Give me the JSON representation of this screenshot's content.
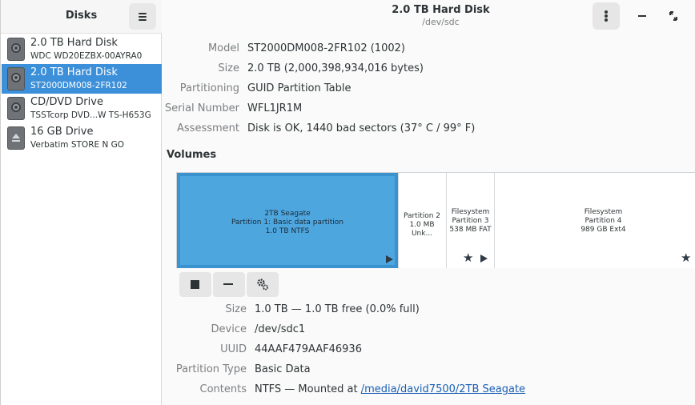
{
  "sidebar": {
    "title": "Disks",
    "drives": [
      {
        "name": "2.0 TB Hard Disk",
        "sub": "WDC WD20EZBX-00AYRA0",
        "icon": "hard-disk-icon",
        "selected": false
      },
      {
        "name": "2.0 TB Hard Disk",
        "sub": "ST2000DM008-2FR102",
        "icon": "hard-disk-icon",
        "selected": true
      },
      {
        "name": "CD/DVD Drive",
        "sub": "TSSTcorp DVD...W TS-H653G",
        "icon": "optical-drive-icon",
        "selected": false
      },
      {
        "name": "16 GB Drive",
        "sub": "Verbatim STORE N GO",
        "icon": "removable-drive-icon",
        "selected": false
      }
    ]
  },
  "header": {
    "title": "2.0 TB Hard Disk",
    "device": "/dev/sdc"
  },
  "disk_info": {
    "model_label": "Model",
    "model": "ST2000DM008-2FR102 (1002)",
    "size_label": "Size",
    "size": "2.0 TB (2,000,398,934,016 bytes)",
    "partitioning_label": "Partitioning",
    "partitioning": "GUID Partition Table",
    "serial_label": "Serial Number",
    "serial": "WFL1JR1M",
    "assessment_label": "Assessment",
    "assessment": "Disk is OK, 1440 bad sectors (37° C / 99° F)"
  },
  "volumes": {
    "heading": "Volumes",
    "items": [
      {
        "line1": "2TB Seagate",
        "line2": "Partition 1: Basic data partition",
        "line3": "1.0 TB NTFS",
        "selected": true
      },
      {
        "line1": "Partition 2",
        "line2": "1.0 MB Unk...",
        "selected": false
      },
      {
        "line1": "Filesystem",
        "line2": "Partition 3",
        "line3": "538 MB FAT",
        "selected": false
      },
      {
        "line1": "Filesystem",
        "line2": "Partition 4",
        "line3": "989 GB Ext4",
        "selected": false
      }
    ]
  },
  "partition_info": {
    "size_label": "Size",
    "size": "1.0 TB — 1.0 TB free (0.0% full)",
    "device_label": "Device",
    "device": "/dev/sdc1",
    "uuid_label": "UUID",
    "uuid": "44AAF479AAF46936",
    "type_label": "Partition Type",
    "type": "Basic Data",
    "contents_label": "Contents",
    "contents_prefix": "NTFS — Mounted at",
    "mount_link": "/media/david7500/2TB Seagate"
  },
  "colors": {
    "accent": "#3c8fd9",
    "volume_selected": "#4ea6df",
    "link": "#1a5fb4"
  }
}
